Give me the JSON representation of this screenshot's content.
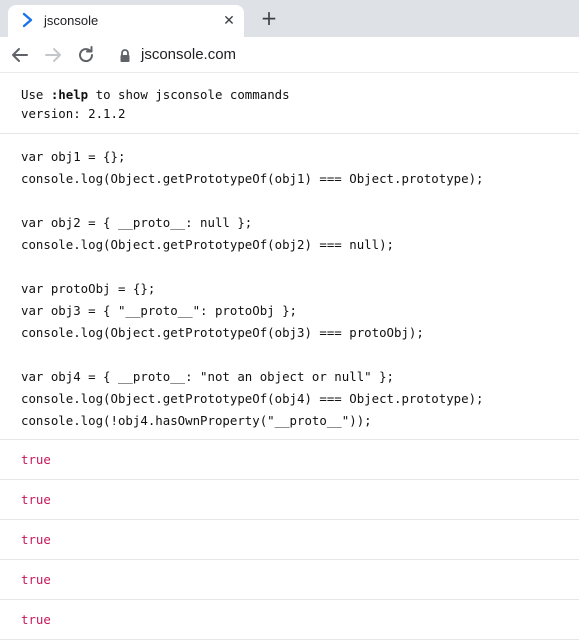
{
  "browser": {
    "tab_title": "jsconsole",
    "close_glyph": "✕",
    "newtab_glyph": "+",
    "url": "jsconsole.com",
    "accent_color": "#1a73e8",
    "icons": [
      "terminal-prompt-icon",
      "close-icon",
      "plus-icon",
      "back-arrow-icon",
      "forward-arrow-icon",
      "reload-icon",
      "lock-icon"
    ]
  },
  "console": {
    "help_prefix": "Use ",
    "help_cmd": ":help",
    "help_suffix": " to show jsconsole commands",
    "version_line": "version: 2.1.2",
    "code_lines": [
      "var obj1 = {};",
      "console.log(Object.getPrototypeOf(obj1) === Object.prototype);",
      "",
      "var obj2 = { __proto__: null };",
      "console.log(Object.getPrototypeOf(obj2) === null);",
      "",
      "var protoObj = {};",
      "var obj3 = { \"__proto__\": protoObj };",
      "console.log(Object.getPrototypeOf(obj3) === protoObj);",
      "",
      "var obj4 = { __proto__: \"not an object or null\" };",
      "console.log(Object.getPrototypeOf(obj4) === Object.prototype);",
      "console.log(!obj4.hasOwnProperty(\"__proto__\"));"
    ],
    "results": [
      "true",
      "true",
      "true",
      "true",
      "true"
    ],
    "result_color": "#c41a5c"
  }
}
